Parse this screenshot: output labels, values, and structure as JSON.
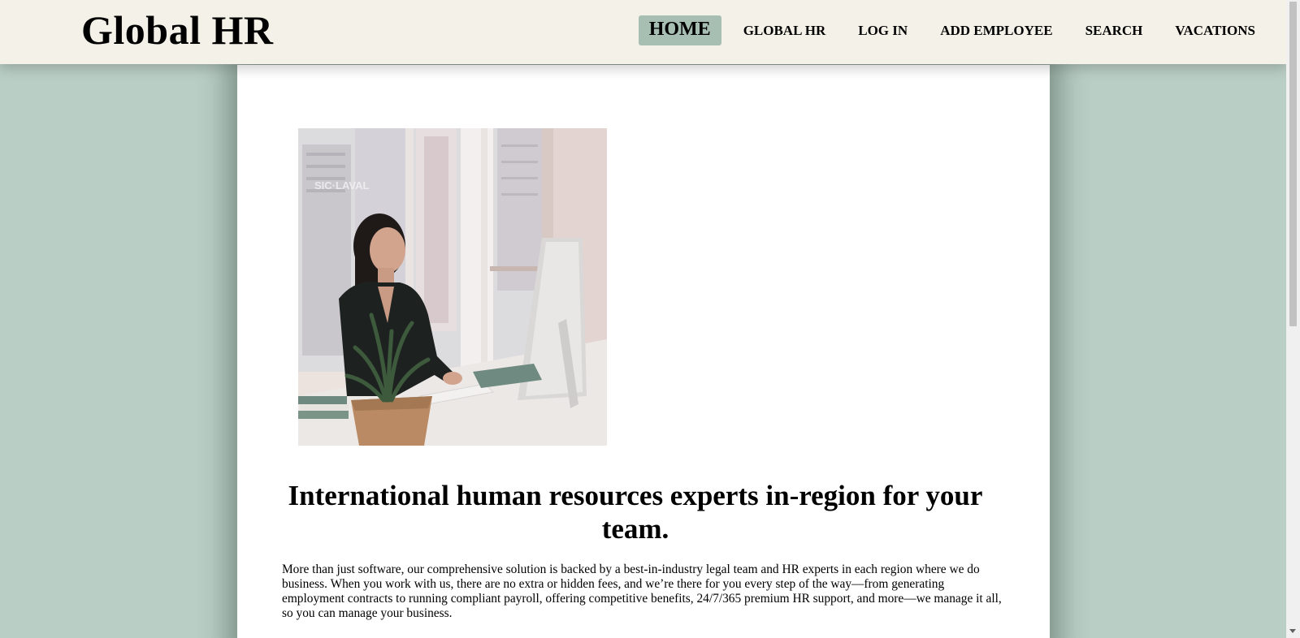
{
  "header": {
    "brand": "Global HR",
    "nav": [
      {
        "label": "HOME",
        "active": true
      },
      {
        "label": "GLOBAL HR",
        "active": false
      },
      {
        "label": "LOG IN",
        "active": false
      },
      {
        "label": "ADD EMPLOYEE",
        "active": false
      },
      {
        "label": "SEARCH",
        "active": false
      },
      {
        "label": "VACATIONS",
        "active": false
      }
    ]
  },
  "main": {
    "image_alt": "woman-at-desk-photo",
    "headline": "International human resources experts in-region for your team.",
    "body": "More than just software, our comprehensive solution is backed by a best-in-industry legal team and HR experts in each region where we do business. When you work with us, there are no extra or hidden fees, and we’re there for you every step of the way—from generating employment contracts to running compliant payroll, offering competitive benefits, 24/7/365 premium HR support, and more—we manage it all, so you can manage your business."
  },
  "colors": {
    "page_background": "#b9cec4",
    "header_background": "#f4f2e8",
    "active_nav": "#a7bfb3",
    "content_background": "#ffffff"
  }
}
